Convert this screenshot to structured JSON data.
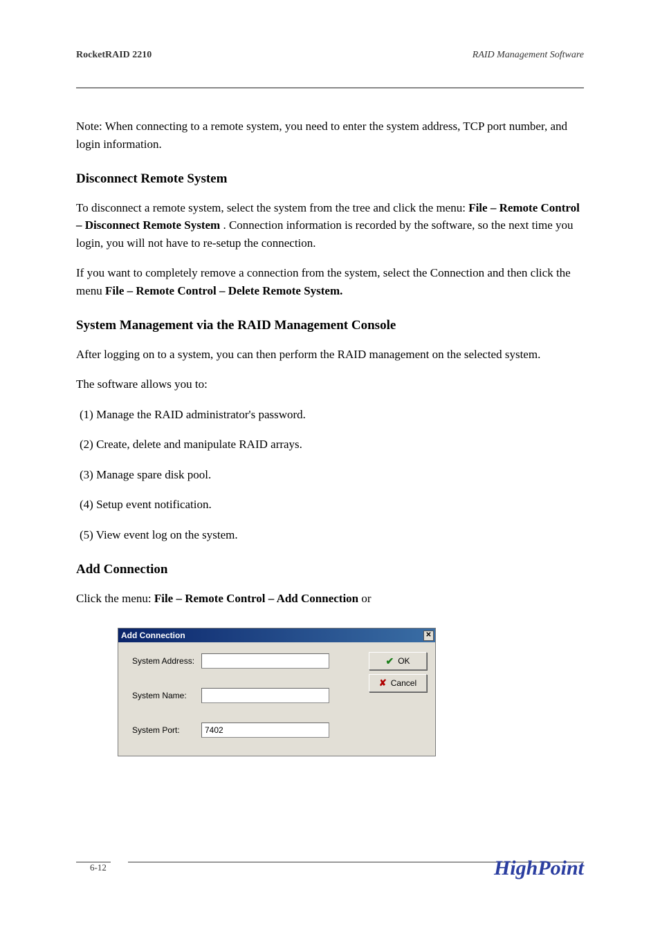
{
  "header": {
    "left": "RocketRAID 2210",
    "right": "RAID Management Software"
  },
  "body": {
    "p1": "Note: When connecting to a remote system, you need to enter the system address, TCP port number, and login information.",
    "h1_title": "Disconnect Remote System",
    "h1_p1": "To disconnect a remote system, select the system from the tree and click the menu: ",
    "h1_p1_bold": "File – Remote Control – Disconnect Remote System",
    "h1_p1_end": ". Connection information is recorded by the software, so the next time you login, you will not have to re-setup the connection.",
    "h1_p2": "If you want to completely remove a connection from the system, select the Connection and then click the menu ",
    "h1_p2_bold": "File – Remote Control – Delete Remote System.",
    "h2_title": "System Management via the RAID Management Console",
    "h2_p1": "After logging on to a system, you can then perform the RAID management on the selected system.",
    "h2_ul_intro": "The software allows you to:",
    "h2_li1": "(1) Manage the RAID administrator's password.",
    "h2_li2": "(2) Create, delete and manipulate RAID arrays.",
    "h2_li3": "(3) Manage spare disk pool.",
    "h2_li4": "(4) Setup event notification.",
    "h2_li5": "(5) View event log on the system.",
    "h3_title": "Add Connection",
    "h3_p1_a": "Click the menu: ",
    "h3_p1_bold": "File – Remote Control – Add Connection ",
    "h3_p1_b": "or"
  },
  "dialog": {
    "title": "Add Connection",
    "labels": {
      "address": "System Address:",
      "name": "System Name:",
      "port": "System Port:"
    },
    "values": {
      "address": "",
      "name": "",
      "port": "7402"
    },
    "buttons": {
      "ok": "OK",
      "cancel": "Cancel"
    }
  },
  "footer": {
    "page": "6-12",
    "logo": "HighPoint"
  }
}
